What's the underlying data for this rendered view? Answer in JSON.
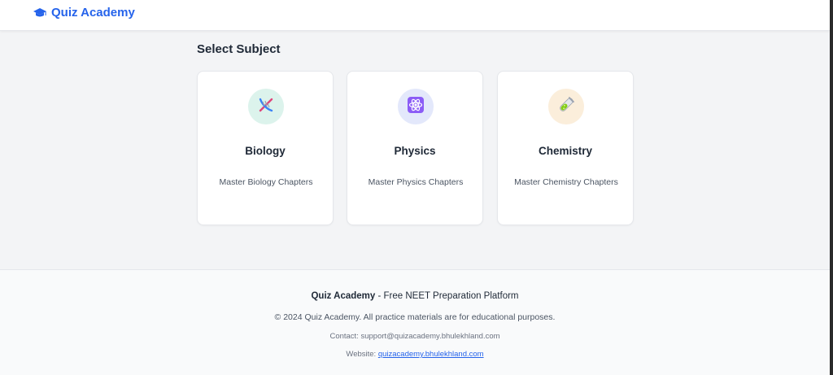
{
  "header": {
    "brand_name": "Quiz Academy",
    "brand_icon": "graduation-cap-icon",
    "brand_color": "#2563eb"
  },
  "main": {
    "section_title": "Select Subject",
    "subjects": [
      {
        "title": "Biology",
        "description": "Master Biology Chapters",
        "icon": "dna-icon",
        "icon_bg": "#dcf3ec"
      },
      {
        "title": "Physics",
        "description": "Master Physics Chapters",
        "icon": "atom-icon",
        "icon_bg": "#e3e8fb"
      },
      {
        "title": "Chemistry",
        "description": "Master Chemistry Chapters",
        "icon": "test-tube-icon",
        "icon_bg": "#fbeedb"
      }
    ]
  },
  "footer": {
    "brand": "Quiz Academy",
    "tagline": " - Free NEET Preparation Platform",
    "copyright": "© 2024 Quiz Academy. All practice materials are for educational purposes.",
    "contact": "Contact: support@quizacademy.bhulekhland.com",
    "website_label": "Website: ",
    "website_link": "quizacademy.bhulekhland.com"
  }
}
